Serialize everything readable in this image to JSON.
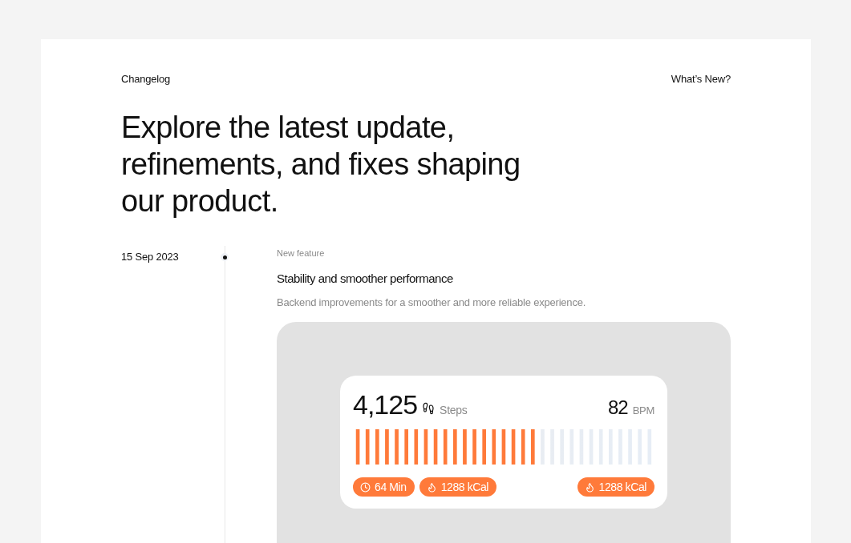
{
  "header": {
    "title": "Changelog",
    "link": "What’s New?"
  },
  "headline": "Explore the latest update, refinements, and fixes shaping our product.",
  "entries": [
    {
      "date": "15 Sep 2023",
      "tag": "New feature",
      "title": "Stability and smoother performance",
      "description": "Backend improvements for a smoother and more reliable experience.",
      "preview": {
        "steps": {
          "value": "4,125",
          "unit": "Steps"
        },
        "heart_rate": {
          "value": "82",
          "unit": "BPM"
        },
        "activity": {
          "level": 0.61
        },
        "badges_left": [
          {
            "kind": "time",
            "label": "64 Min"
          },
          {
            "kind": "calories",
            "label": "1288 kCal"
          }
        ],
        "badges_right": [
          {
            "kind": "calories",
            "label": "1288 kCal"
          }
        ]
      }
    }
  ]
}
